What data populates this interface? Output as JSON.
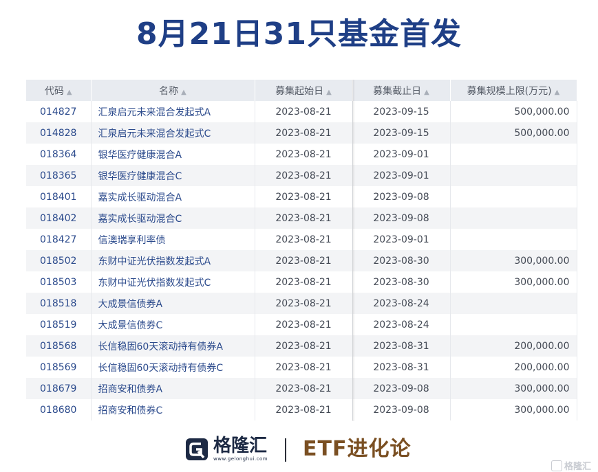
{
  "title": "8月21日31只基金首发",
  "table": {
    "headers": [
      "代码",
      "名称",
      "募集起始日",
      "募集截止日",
      "募集规模上限(万元)"
    ],
    "rows": [
      [
        "014827",
        "汇泉启元未来混合发起式A",
        "2023-08-21",
        "2023-09-15",
        "500,000.00"
      ],
      [
        "014828",
        "汇泉启元未来混合发起式C",
        "2023-08-21",
        "2023-09-15",
        "500,000.00"
      ],
      [
        "018364",
        "银华医疗健康混合A",
        "2023-08-21",
        "2023-09-01",
        ""
      ],
      [
        "018365",
        "银华医疗健康混合C",
        "2023-08-21",
        "2023-09-01",
        ""
      ],
      [
        "018401",
        "嘉实成长驱动混合A",
        "2023-08-21",
        "2023-09-08",
        ""
      ],
      [
        "018402",
        "嘉实成长驱动混合C",
        "2023-08-21",
        "2023-09-08",
        ""
      ],
      [
        "018427",
        "信澳瑞享利率债",
        "2023-08-21",
        "2023-09-01",
        ""
      ],
      [
        "018502",
        "东财中证光伏指数发起式A",
        "2023-08-21",
        "2023-08-30",
        "300,000.00"
      ],
      [
        "018503",
        "东财中证光伏指数发起式C",
        "2023-08-21",
        "2023-08-30",
        "300,000.00"
      ],
      [
        "018518",
        "大成景信债券A",
        "2023-08-21",
        "2023-08-24",
        ""
      ],
      [
        "018519",
        "大成景信债券C",
        "2023-08-21",
        "2023-08-24",
        ""
      ],
      [
        "018568",
        "长信稳固60天滚动持有债券A",
        "2023-08-21",
        "2023-08-31",
        "200,000.00"
      ],
      [
        "018569",
        "长信稳固60天滚动持有债券C",
        "2023-08-21",
        "2023-08-31",
        "200,000.00"
      ],
      [
        "018679",
        "招商安和债券A",
        "2023-08-21",
        "2023-09-08",
        "300,000.00"
      ],
      [
        "018680",
        "招商安和债券C",
        "2023-08-21",
        "2023-09-08",
        "300,000.00"
      ]
    ]
  },
  "footer": {
    "logo_text": "格隆汇",
    "logo_url": "www.gelonghui.com",
    "brand": "ETF进化论",
    "watermark": "格隆汇"
  },
  "colors": {
    "title": "#1f3f86",
    "link": "#2b4a8c",
    "header_bg": "#e8ebf0",
    "brand": "#7a4f22"
  },
  "icons": {
    "sort": "sort-icon",
    "logo": "gelonghui-logo-icon"
  }
}
